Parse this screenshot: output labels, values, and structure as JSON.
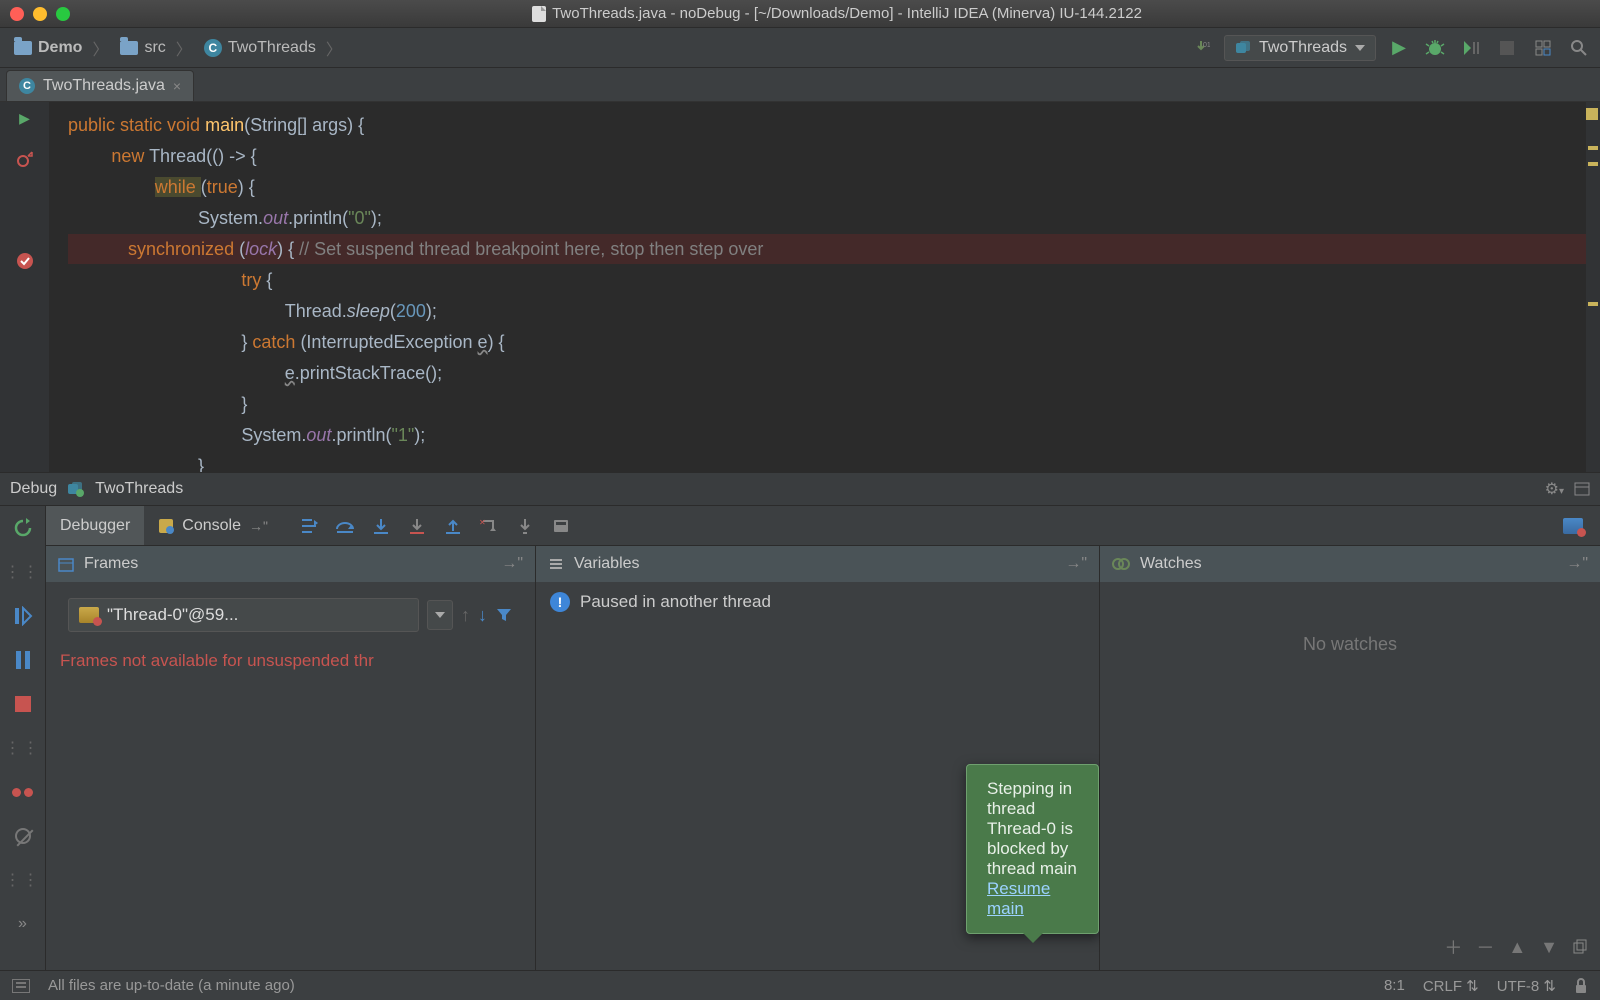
{
  "titlebar": {
    "title": "TwoThreads.java - noDebug - [~/Downloads/Demo] - IntelliJ IDEA (Minerva) IU-144.2122"
  },
  "breadcrumbs": {
    "project": "Demo",
    "folder": "src",
    "class": "TwoThreads"
  },
  "run_config": {
    "selected": "TwoThreads"
  },
  "editor_tab": {
    "label": "TwoThreads.java"
  },
  "code": {
    "l1a": "public ",
    "l1b": "static ",
    "l1c": "void ",
    "l1d": "main",
    "l1e": "(String[] args) {",
    "l2a": "new ",
    "l2b": "Thread(() -> {",
    "l3a": "while ",
    "l3b": "(",
    "l3c": "true",
    "l3d": ") {",
    "l4a": "System.",
    "l4b": "out",
    "l4c": ".println(",
    "l4d": "\"0\"",
    "l4e": ");",
    "l5a": "synchronized ",
    "l5b": "(",
    "l5c": "lock",
    "l5d": ") { ",
    "l5e": "// Set suspend thread breakpoint here, stop then step over",
    "l6a": "try ",
    "l6b": "{",
    "l7a": "Thread.",
    "l7b": "sleep",
    "l7c": "(",
    "l7d": "200",
    "l7e": ");",
    "l8a": "} ",
    "l8b": "catch ",
    "l8c": "(InterruptedException ",
    "l8d": "e",
    "l8e": ") {",
    "l9a": "e",
    "l9b": ".printStackTrace();",
    "l10": "}",
    "l11a": "System.",
    "l11b": "out",
    "l11c": ".println(",
    "l11d": "\"1\"",
    "l11e": ");",
    "l12": "}"
  },
  "debug": {
    "toolwindow_label": "Debug",
    "config_name": "TwoThreads",
    "tabs": {
      "debugger": "Debugger",
      "console": "Console"
    },
    "frames": {
      "title": "Frames",
      "thread": "\"Thread-0\"@59...",
      "message": "Frames not available for unsuspended thr"
    },
    "variables": {
      "title": "Variables",
      "message": "Paused in another thread"
    },
    "watches": {
      "title": "Watches",
      "empty": "No watches"
    }
  },
  "tooltip": {
    "text": "Stepping in thread Thread-0 is blocked by thread main",
    "link": "Resume main"
  },
  "status": {
    "message": "All files are up-to-date (a minute ago)",
    "caret": "8:1",
    "line_sep": "CRLF",
    "encoding": "UTF-8"
  }
}
